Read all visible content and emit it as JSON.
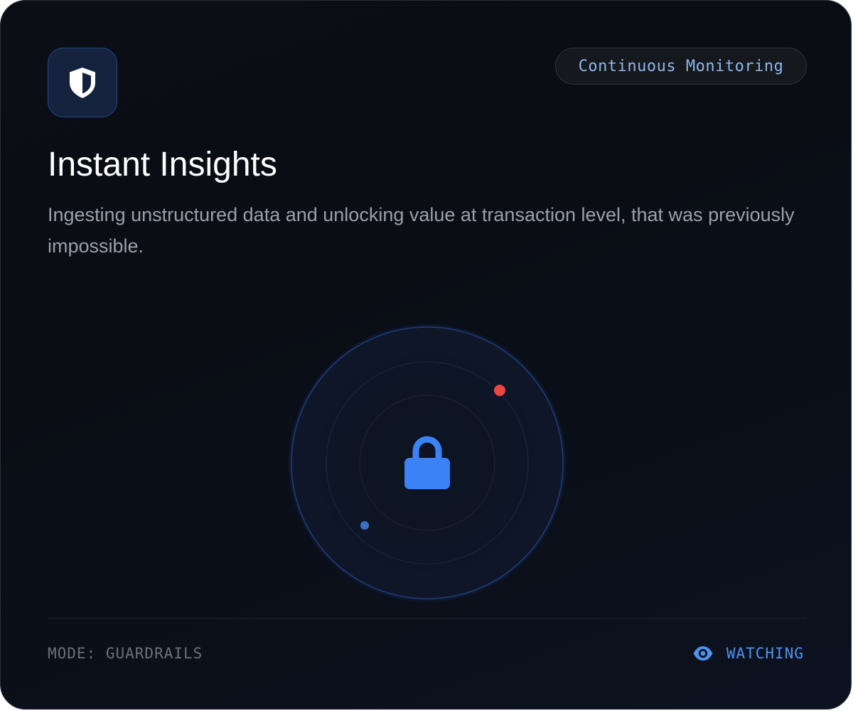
{
  "header": {
    "badge_label": "Continuous Monitoring",
    "icon": "shield-icon"
  },
  "content": {
    "title": "Instant Insights",
    "description": "Ingesting unstructured data and unlocking value at transaction level, that was previously impossible."
  },
  "radar": {
    "center_icon": "lock-icon",
    "blip_colors": [
      "#ef4444",
      "#3b6fc4"
    ],
    "accent_color": "#3b82f6"
  },
  "footer": {
    "mode_label": "MODE: GUARDRAILS",
    "status_label": "WATCHING",
    "status_icon": "eye-icon",
    "status_color": "#4f93f0"
  }
}
